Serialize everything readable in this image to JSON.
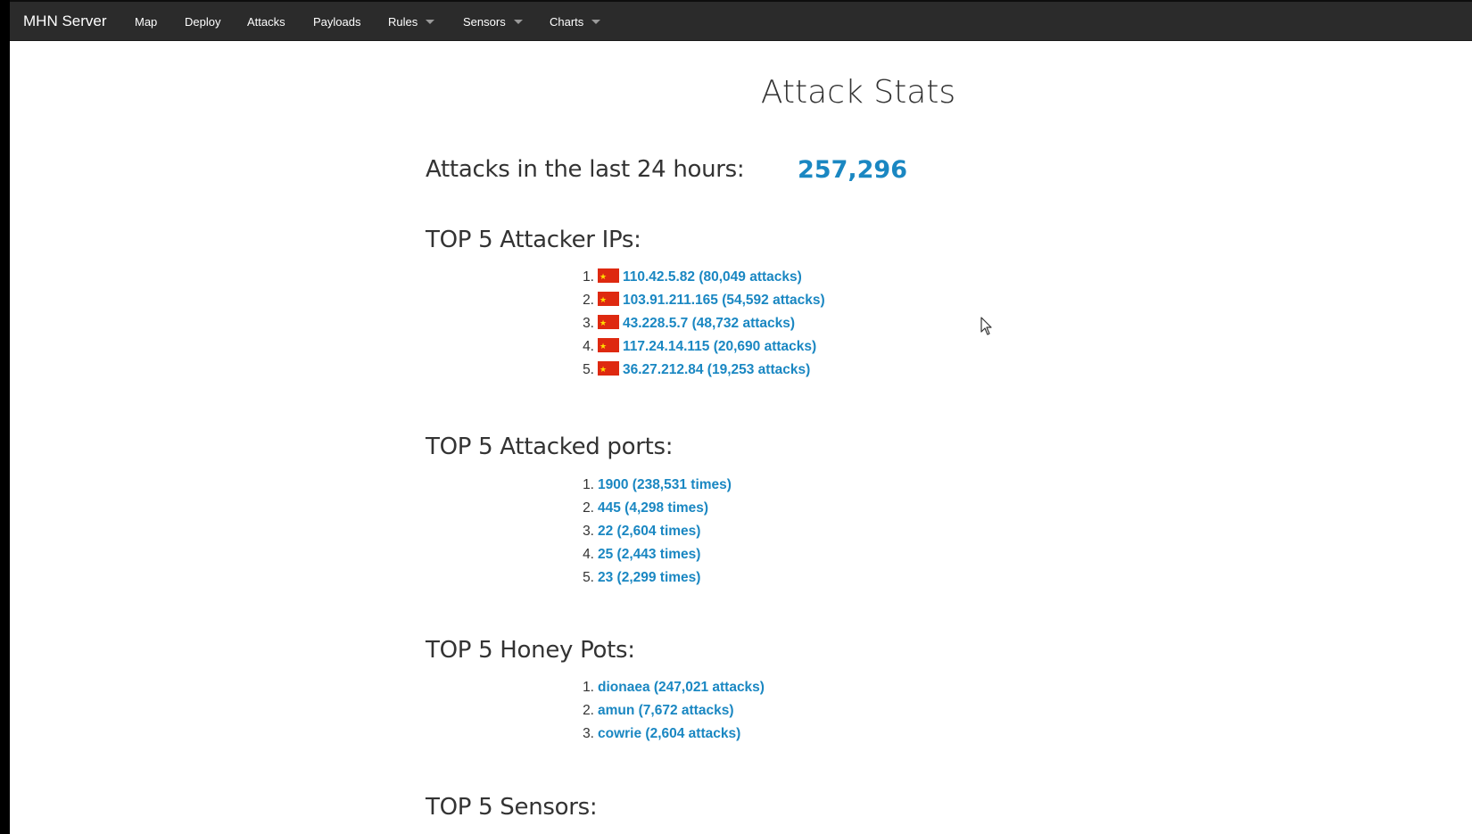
{
  "navbar": {
    "brand": "MHN Server",
    "items": [
      {
        "label": "Map",
        "dropdown": false
      },
      {
        "label": "Deploy",
        "dropdown": false
      },
      {
        "label": "Attacks",
        "dropdown": false
      },
      {
        "label": "Payloads",
        "dropdown": false
      },
      {
        "label": "Rules",
        "dropdown": true
      },
      {
        "label": "Sensors",
        "dropdown": true
      },
      {
        "label": "Charts",
        "dropdown": true
      }
    ]
  },
  "page": {
    "title": "Attack Stats",
    "attacks_24h_label": "Attacks in the last 24 hours:",
    "attacks_24h_value": "257,296",
    "top_ips": {
      "heading": "TOP 5 Attacker IPs:",
      "items": [
        {
          "num": "1.",
          "text": "110.42.5.82 (80,049 attacks)",
          "flag": "china-flag-icon"
        },
        {
          "num": "2.",
          "text": "103.91.211.165 (54,592 attacks)",
          "flag": "china-flag-icon"
        },
        {
          "num": "3.",
          "text": "43.228.5.7 (48,732 attacks)",
          "flag": "china-flag-icon"
        },
        {
          "num": "4.",
          "text": "117.24.14.115 (20,690 attacks)",
          "flag": "china-flag-icon"
        },
        {
          "num": "5.",
          "text": "36.27.212.84 (19,253 attacks)",
          "flag": "china-flag-icon"
        }
      ]
    },
    "top_ports": {
      "heading": "TOP 5 Attacked ports:",
      "items": [
        {
          "num": "1.",
          "text": "1900 (238,531 times)"
        },
        {
          "num": "2.",
          "text": "445 (4,298 times)"
        },
        {
          "num": "3.",
          "text": "22 (2,604 times)"
        },
        {
          "num": "4.",
          "text": "25 (2,443 times)"
        },
        {
          "num": "5.",
          "text": "23 (2,299 times)"
        }
      ]
    },
    "top_honeypots": {
      "heading": "TOP 5 Honey Pots:",
      "items": [
        {
          "num": "1.",
          "text": "dionaea (247,021 attacks)"
        },
        {
          "num": "2.",
          "text": "amun (7,672 attacks)"
        },
        {
          "num": "3.",
          "text": "cowrie (2,604 attacks)"
        }
      ]
    },
    "top_sensors": {
      "heading": "TOP 5 Sensors:"
    }
  },
  "colors": {
    "navbar_bg": "#2b2b2b",
    "link": "#1a87c2",
    "text": "#333333"
  }
}
